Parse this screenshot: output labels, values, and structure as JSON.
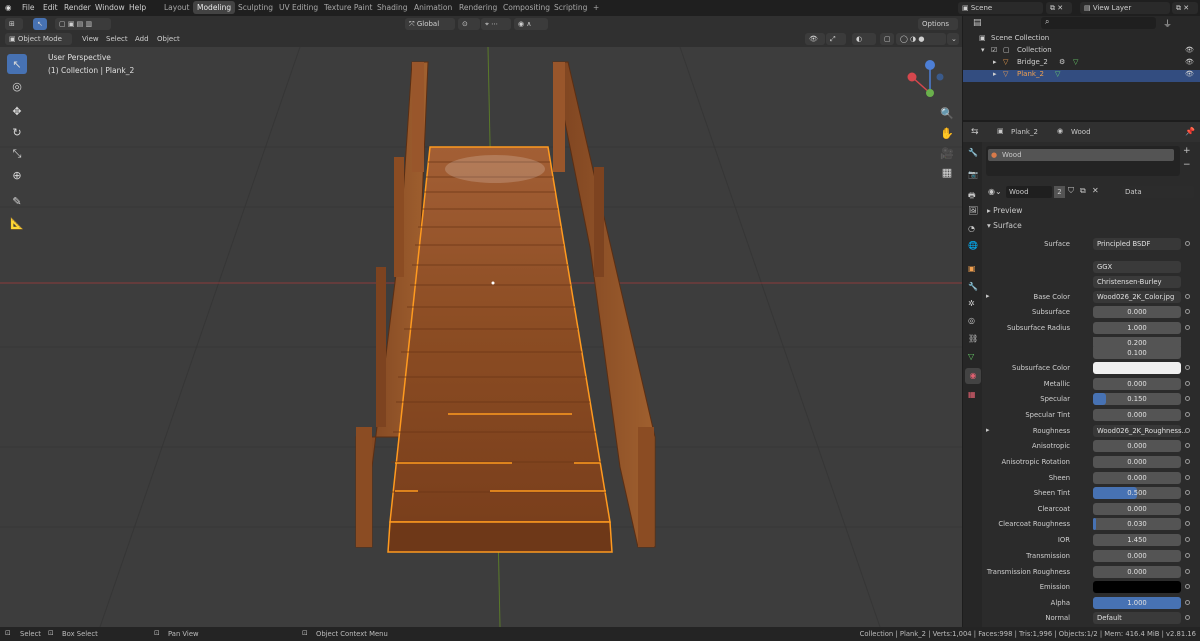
{
  "menu": {
    "file": "File",
    "edit": "Edit",
    "render": "Render",
    "window": "Window",
    "help": "Help"
  },
  "workspaces": [
    "Layout",
    "Modeling",
    "Sculpting",
    "UV Editing",
    "Texture Paint",
    "Shading",
    "Animation",
    "Rendering",
    "Compositing",
    "Scripting",
    "+"
  ],
  "scene_field": "Scene",
  "view_layer_field": "View Layer",
  "header": {
    "mode": "Object Mode",
    "view": "View",
    "select": "Select",
    "add": "Add",
    "object": "Object",
    "orientation": "Global",
    "options": "Options"
  },
  "viewport": {
    "perspective": "User Perspective",
    "collection": "(1) Collection | Plank_2"
  },
  "outliner": {
    "scene_collection": "Scene Collection",
    "collection": "Collection",
    "bridge": "Bridge_2",
    "plank": "Plank_2"
  },
  "props": {
    "breadcrumb_obj": "Plank_2",
    "breadcrumb_mat": "Wood",
    "slot": "Wood",
    "mat_name": "Wood",
    "mat_users": "2",
    "mat_link": "Data",
    "preview": "Preview",
    "surface_panel": "Surface",
    "rows": [
      {
        "label": "Surface",
        "value": "Principled BSDF"
      },
      {
        "label": "",
        "value": "GGX"
      },
      {
        "label": "",
        "value": "Christensen-Burley"
      },
      {
        "label": "Base Color",
        "value": "Wood026_2K_Color.jpg"
      },
      {
        "label": "Subsurface",
        "value": "0.000"
      },
      {
        "label": "Subsurface Radius",
        "value": "1.000"
      },
      {
        "label": "",
        "value": "0.200"
      },
      {
        "label": "",
        "value": "0.100"
      },
      {
        "label": "Subsurface Color",
        "value": ""
      },
      {
        "label": "Metallic",
        "value": "0.000"
      },
      {
        "label": "Specular",
        "value": "0.150"
      },
      {
        "label": "Specular Tint",
        "value": "0.000"
      },
      {
        "label": "Roughness",
        "value": "Wood026_2K_Roughness..."
      },
      {
        "label": "Anisotropic",
        "value": "0.000"
      },
      {
        "label": "Anisotropic Rotation",
        "value": "0.000"
      },
      {
        "label": "Sheen",
        "value": "0.000"
      },
      {
        "label": "Sheen Tint",
        "value": "0.500"
      },
      {
        "label": "Clearcoat",
        "value": "0.000"
      },
      {
        "label": "Clearcoat Roughness",
        "value": "0.030"
      },
      {
        "label": "IOR",
        "value": "1.450"
      },
      {
        "label": "Transmission",
        "value": "0.000"
      },
      {
        "label": "Transmission Roughness",
        "value": "0.000"
      },
      {
        "label": "Emission",
        "value": ""
      },
      {
        "label": "Alpha",
        "value": "1.000"
      },
      {
        "label": "Normal",
        "value": "Default"
      }
    ],
    "fills": {
      "specular": 0.15,
      "sheen_tint": 0.5,
      "clearcoat_roughness": 0.03,
      "alpha": 1.0
    }
  },
  "status": {
    "select": "Select",
    "box_select": "Box Select",
    "pan_view": "Pan View",
    "context_menu": "Object Context Menu",
    "info": "Collection | Plank_2 | Verts:1,004 | Faces:998 | Tris:1,996 | Objects:1/2 | Mem: 416.4 MiB | v2.81.16"
  },
  "colors": {
    "accent": "#4772b3",
    "selection": "#ff9a1f",
    "wood": "#8a4a22"
  }
}
